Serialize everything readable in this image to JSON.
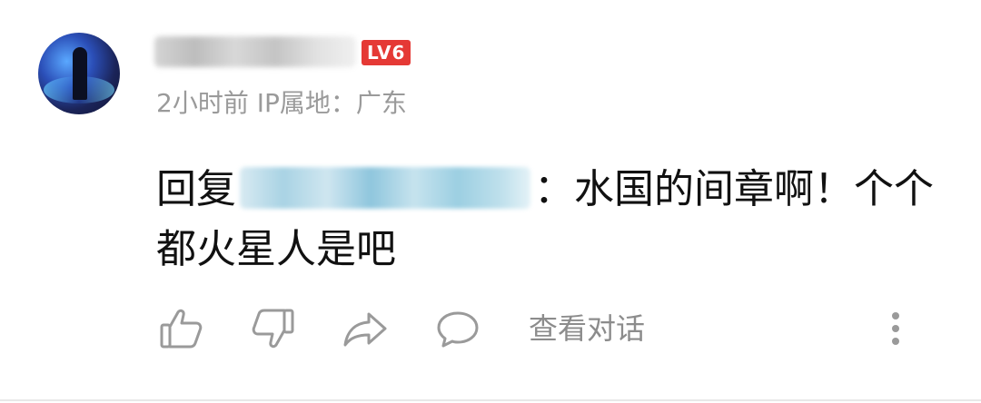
{
  "user": {
    "level_badge": "LV6",
    "time_ago": "2小时前",
    "ip_location": "IP属地：广东"
  },
  "comment": {
    "reply_prefix": "回复",
    "text": "：水国的间章啊！个个都火星人是吧"
  },
  "actions": {
    "like_icon": "thumbs-up-icon",
    "dislike_icon": "thumbs-down-icon",
    "share_icon": "share-arrow-icon",
    "reply_icon": "speech-bubble-icon",
    "view_dialog_label": "查看对话",
    "more_icon": "more-vertical-icon"
  },
  "colors": {
    "badge": "#e53935",
    "meta_text": "#9a9a9a",
    "icon": "#9a9a9a"
  }
}
